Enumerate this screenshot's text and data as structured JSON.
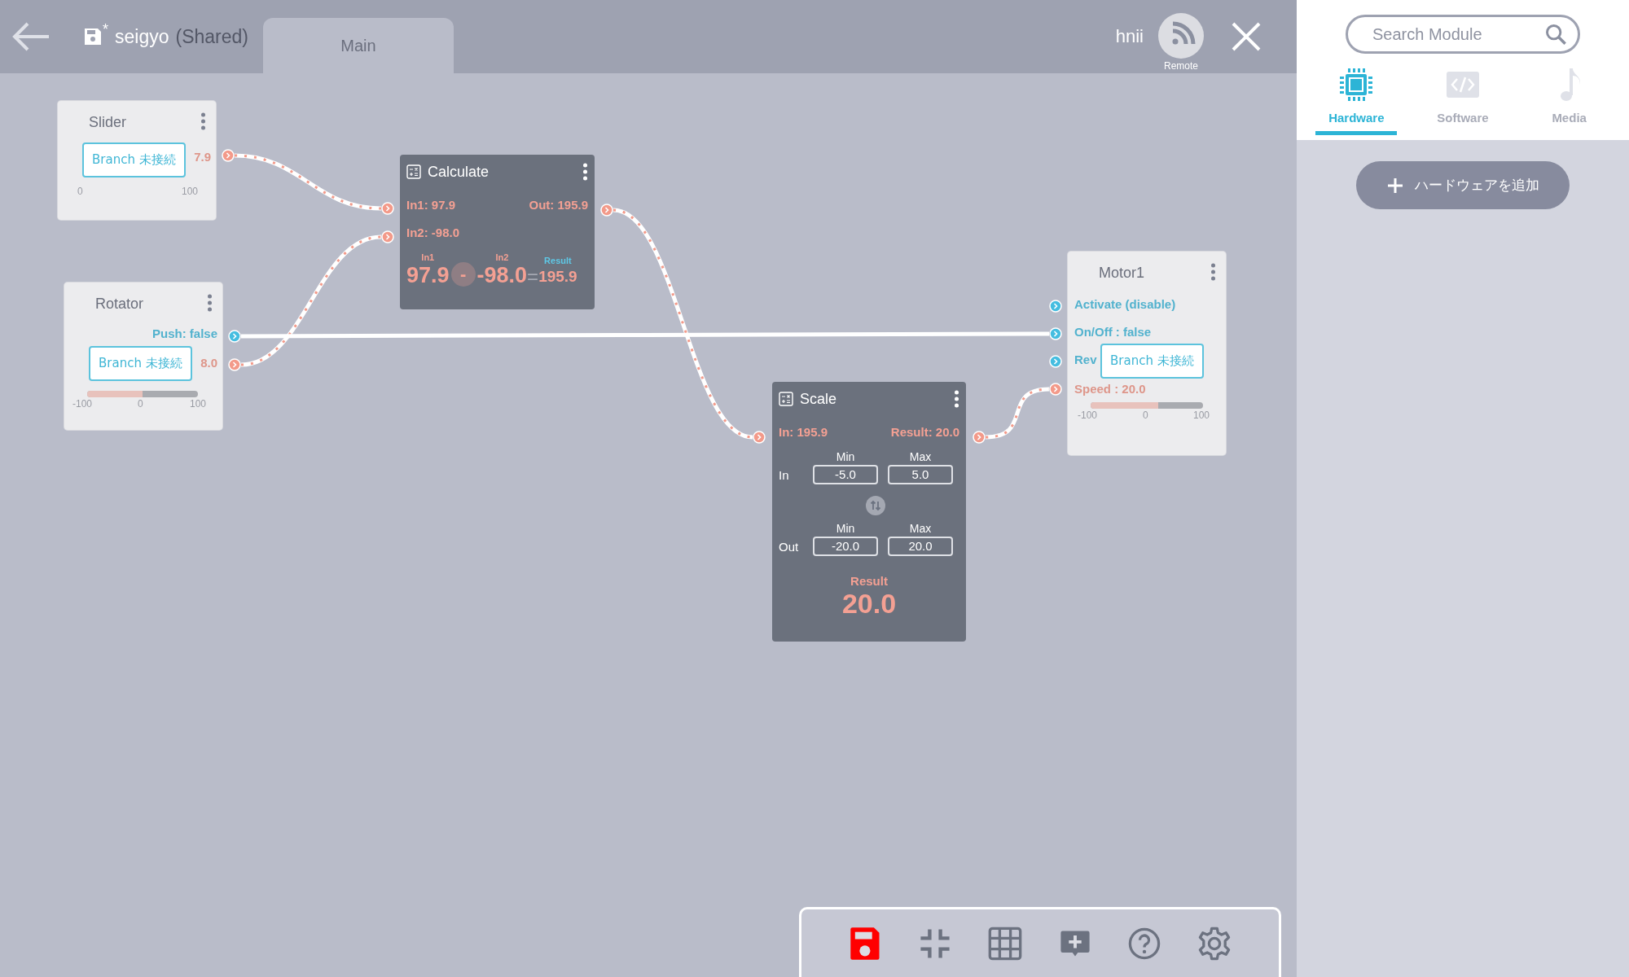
{
  "header": {
    "file_name": "seigyo",
    "shared_label": "(Shared)",
    "unsaved": true,
    "unsaved_mark": "*",
    "user": "hnii",
    "remote_label": "Remote"
  },
  "tabs": [
    {
      "label": "Main",
      "selected": true
    }
  ],
  "nodes": [
    {
      "kind": "slider",
      "title": "Slider",
      "value": "7.9",
      "scale_min": "0",
      "scale_max": "100",
      "branch": "Branch 未接続",
      "ports": [
        {
          "color": "#f39a8a"
        }
      ]
    },
    {
      "kind": "rotator",
      "title": "Rotator",
      "push": "Push: false",
      "value": "8.0",
      "level": 0.5,
      "scale_min": "-100",
      "scale_mid": "0",
      "scale_max": "100",
      "branch": "Branch 未接続",
      "ports": [
        {
          "color": "#45bde0"
        },
        {
          "color": "#f39a8a"
        }
      ]
    },
    {
      "kind": "calculate",
      "title": "Calculate",
      "in1": "In1: 97.9",
      "in2": "In2: -98.0",
      "out": "Out: 195.9",
      "in1_label": "In1",
      "in2_label": "In2",
      "result_label": "Result",
      "in1_value": "97.9",
      "operator": "-",
      "in2_value": "-98.0",
      "equals": "=",
      "result_value": "195.9",
      "ports": [
        {
          "color": "#f39a8a"
        },
        {
          "color": "#f39a8a"
        },
        {
          "color": "#f39a8a"
        }
      ]
    },
    {
      "kind": "scale",
      "title": "Scale",
      "in": "In: 195.9",
      "out": "Result: 20.0",
      "rows": [
        {
          "label": "In",
          "min_label": "Min",
          "max_label": "Max",
          "min": "-5.0",
          "max": "5.0"
        },
        {
          "label": "Out",
          "min_label": "Min",
          "max_label": "Max",
          "min": "-20.0",
          "max": "20.0"
        }
      ],
      "result_label": "Result",
      "result_value": "20.0",
      "ports": [
        {
          "color": "#f39a8a"
        },
        {
          "color": "#f39a8a"
        }
      ]
    },
    {
      "kind": "motor",
      "title": "Motor1",
      "rows": [
        "Activate (disable)",
        "On/Off : false",
        "Rev",
        "Speed : 20.0"
      ],
      "level": 0.6,
      "scale_min": "-100",
      "scale_mid": "0",
      "scale_max": "100",
      "branch": "Branch 未接続",
      "ports": [
        {
          "color": "#45bde0"
        },
        {
          "color": "#45bde0"
        },
        {
          "color": "#45bde0"
        },
        {
          "color": "#f39a8a"
        }
      ]
    }
  ],
  "panel": {
    "search": {
      "placeholder": "Search Module"
    },
    "categories": [
      {
        "kind": "hardware",
        "label": "Hardware",
        "selected": true
      },
      {
        "kind": "software",
        "label": "Software",
        "selected": false
      },
      {
        "kind": "media",
        "label": "Media",
        "selected": false
      }
    ],
    "add_button": "ハードウェアを追加"
  },
  "toolbar": [
    {
      "kind": "save"
    },
    {
      "kind": "fit"
    },
    {
      "kind": "grid"
    },
    {
      "kind": "comment"
    },
    {
      "kind": "help"
    },
    {
      "kind": "settings"
    }
  ]
}
